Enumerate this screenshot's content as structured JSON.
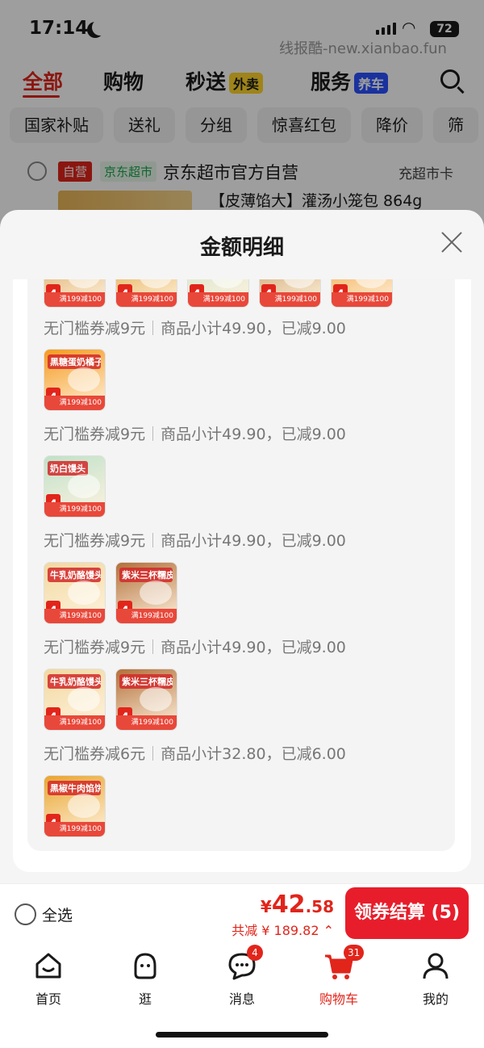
{
  "status": {
    "time": "17:14",
    "battery": "72",
    "watermark": "线报酷-new.xianbao.fun"
  },
  "top_tabs": [
    {
      "label": "全部"
    },
    {
      "label": "购物"
    },
    {
      "label": "秒送",
      "badge": "外卖"
    },
    {
      "label": "服务",
      "badge": "养车"
    }
  ],
  "chips": [
    "国家补贴",
    "送礼",
    "分组",
    "惊喜红包",
    "降价",
    "筛"
  ],
  "store": {
    "self_tag": "自营",
    "market_tag": "京东超市",
    "name": "京东超市官方自营",
    "card_link": "充超市卡",
    "product_title": "【皮薄馅大】灌汤小笼包 864g"
  },
  "sheet": {
    "title": "金额明细",
    "groups": [
      {
        "items": [
          {
            "name": "",
            "color": "#d9a45a"
          },
          {
            "name": "",
            "color": "#e0a23a"
          },
          {
            "name": "",
            "color": "#cfe3c8"
          },
          {
            "name": "",
            "color": "#c79a5e"
          },
          {
            "name": "",
            "color": "#f0a13a"
          }
        ],
        "coupon": "无门槛券减",
        "amount": "9",
        "unit": "元",
        "subtotal_label": "商品小计",
        "subtotal": "49.90",
        "reduced_label": "已减",
        "reduced": "9.00"
      },
      {
        "items": [
          {
            "name": "黑糖蛋奶橘子包",
            "color": "#f59a1e"
          }
        ],
        "coupon": "无门槛券减",
        "amount": "9",
        "unit": "元",
        "subtotal_label": "商品小计",
        "subtotal": "49.90",
        "reduced_label": "已减",
        "reduced": "9.00"
      },
      {
        "items": [
          {
            "name": "奶白馒头",
            "color": "#bfe1c9"
          }
        ],
        "coupon": "无门槛券减",
        "amount": "9",
        "unit": "元",
        "subtotal_label": "商品小计",
        "subtotal": "49.90",
        "reduced_label": "已减",
        "reduced": "9.00"
      },
      {
        "items": [
          {
            "name": "牛乳奶酪馒头",
            "color": "#f2d9a0"
          },
          {
            "name": "紫米三杯糯皮烧麦",
            "color": "#b3703a"
          }
        ],
        "coupon": "无门槛券减",
        "amount": "9",
        "unit": "元",
        "subtotal_label": "商品小计",
        "subtotal": "49.90",
        "reduced_label": "已减",
        "reduced": "9.00"
      },
      {
        "items": [
          {
            "name": "牛乳奶酪馒头",
            "color": "#f2d9a0"
          },
          {
            "name": "紫米三杯糯皮烧麦",
            "color": "#b3703a"
          }
        ],
        "coupon": "无门槛券减",
        "amount": "6",
        "unit": "元",
        "subtotal_label": "商品小计",
        "subtotal": "32.80",
        "reduced_label": "已减",
        "reduced": "6.00"
      },
      {
        "items": [
          {
            "name": "黑椒牛肉馅饼",
            "color": "#e8a52f"
          }
        ],
        "coupon": "",
        "amount": "",
        "unit": "",
        "subtotal_label": "",
        "subtotal": "",
        "reduced_label": "",
        "reduced": ""
      }
    ],
    "promo_text": "满199减100",
    "promo_number": "4"
  },
  "checkout": {
    "select_all": "全选",
    "price_currency": "¥",
    "price_int": "42",
    "price_dec": ".58",
    "discount": "共减 ¥ 189.82",
    "button": "领券结算 (5)"
  },
  "tab_bar": [
    {
      "label": "首页",
      "icon": "home-icon"
    },
    {
      "label": "逛",
      "icon": "stroll-icon"
    },
    {
      "label": "消息",
      "icon": "message-icon",
      "badge": "4"
    },
    {
      "label": "购物车",
      "icon": "cart-icon",
      "badge": "31",
      "active": true
    },
    {
      "label": "我的",
      "icon": "profile-icon"
    }
  ],
  "colors": {
    "accent": "#e1251b",
    "green": "#19a34b"
  }
}
